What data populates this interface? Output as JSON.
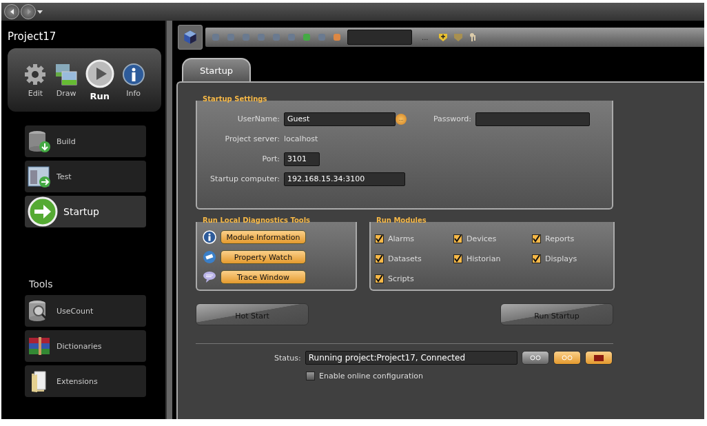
{
  "project": {
    "title": "Project17"
  },
  "modes": [
    {
      "label": "Edit",
      "selected": false
    },
    {
      "label": "Draw",
      "selected": false
    },
    {
      "label": "Run",
      "selected": true
    },
    {
      "label": "Info",
      "selected": false
    }
  ],
  "actions": [
    {
      "label": "Build",
      "selected": false
    },
    {
      "label": "Test",
      "selected": false
    },
    {
      "label": "Startup",
      "selected": true
    }
  ],
  "tools": {
    "heading": "Tools",
    "items": [
      {
        "label": "UseCount"
      },
      {
        "label": "Dictionaries"
      },
      {
        "label": "Extensions"
      }
    ]
  },
  "toolbar": {
    "more": "..."
  },
  "tabs": [
    {
      "label": "Startup",
      "selected": true
    }
  ],
  "startup_settings": {
    "title": "Startup Settings",
    "username_label": "UserName:",
    "username": "Guest",
    "browse": "...",
    "password_label": "Password:",
    "server_label": "Project server:",
    "server": "localhost",
    "port_label": "Port:",
    "port": "3101",
    "computer_label": "Startup computer:",
    "computer": "192.168.15.34:3100"
  },
  "diagnostics": {
    "title": "Run Local Diagnostics Tools",
    "buttons": [
      {
        "label": "Module Information"
      },
      {
        "label": "Property Watch"
      },
      {
        "label": "Trace Window"
      }
    ]
  },
  "modules": {
    "title": "Run Modules",
    "items": [
      {
        "label": "Alarms",
        "checked": true
      },
      {
        "label": "Devices",
        "checked": true
      },
      {
        "label": "Reports",
        "checked": true
      },
      {
        "label": "Datasets",
        "checked": true
      },
      {
        "label": "Historian",
        "checked": true
      },
      {
        "label": "Displays",
        "checked": true
      },
      {
        "label": "Scripts",
        "checked": true
      }
    ]
  },
  "hot_start": "Hot Start",
  "run_startup": "Run Startup",
  "status": {
    "label": "Status:",
    "value": "Running project:Project17, Connected"
  },
  "online_config": {
    "label": "Enable online configuration",
    "checked": false
  }
}
